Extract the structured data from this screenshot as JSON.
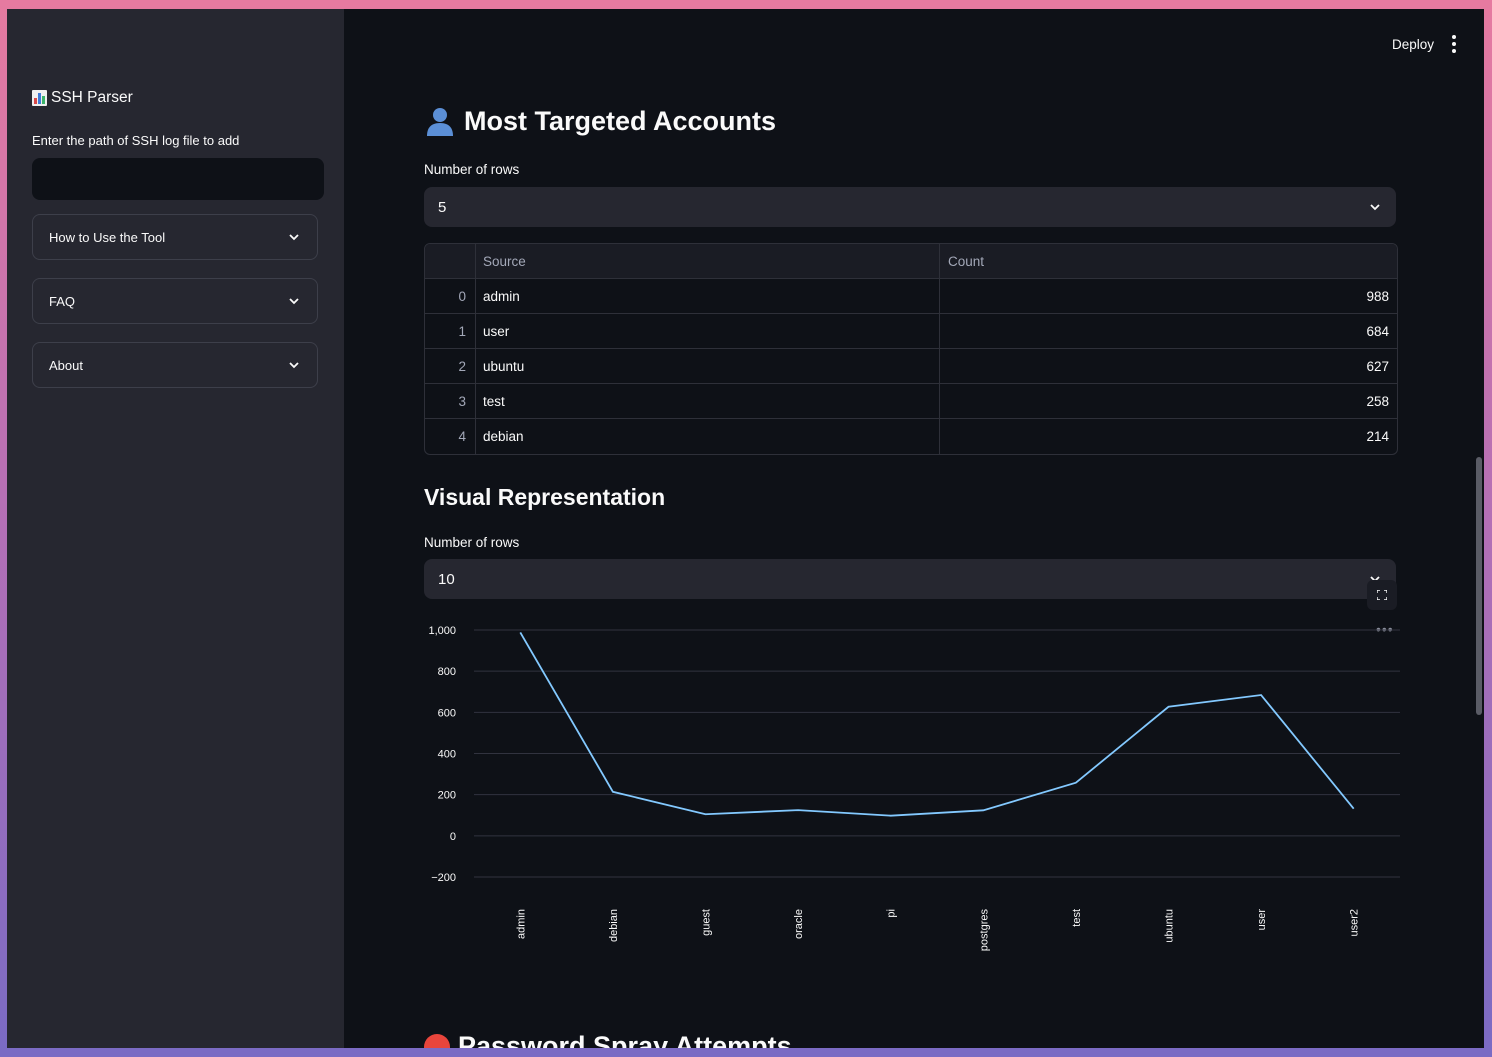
{
  "sidebar": {
    "title": "SSH Parser",
    "path_label": "Enter the path of SSH log file to add",
    "path_value": "",
    "expanders": [
      {
        "label": "How to Use the Tool"
      },
      {
        "label": "FAQ"
      },
      {
        "label": "About"
      }
    ]
  },
  "topbar": {
    "deploy_label": "Deploy"
  },
  "section_accounts": {
    "title": "Most Targeted Accounts",
    "rows_label": "Number of rows",
    "rows_value": "5",
    "table": {
      "headers": [
        "",
        "Source",
        "Count"
      ],
      "rows": [
        {
          "idx": "0",
          "source": "admin",
          "count": "988"
        },
        {
          "idx": "1",
          "source": "user",
          "count": "684"
        },
        {
          "idx": "2",
          "source": "ubuntu",
          "count": "627"
        },
        {
          "idx": "3",
          "source": "test",
          "count": "258"
        },
        {
          "idx": "4",
          "source": "debian",
          "count": "214"
        }
      ]
    }
  },
  "section_visual": {
    "title": "Visual Representation",
    "rows_label": "Number of rows",
    "rows_value": "10"
  },
  "chart_data": {
    "type": "line",
    "categories": [
      "admin",
      "debian",
      "guest",
      "oracle",
      "pi",
      "postgres",
      "test",
      "ubuntu",
      "user",
      "user2"
    ],
    "series": [
      {
        "values": [
          988,
          214,
          105,
          125,
          98,
          124,
          258,
          627,
          684,
          132
        ],
        "color": "#83c9ff"
      }
    ],
    "y_ticks": [
      "1,000",
      "800",
      "600",
      "400",
      "200",
      "0",
      "−200"
    ],
    "ylim": [
      -200,
      1000
    ],
    "xlabel": "",
    "ylabel": "",
    "grid": true
  },
  "bottom_section": {
    "title": "Password Spray Attempts"
  },
  "colors": {
    "background": "#0e1117",
    "sidebar": "#262730",
    "line": "#83c9ff"
  }
}
